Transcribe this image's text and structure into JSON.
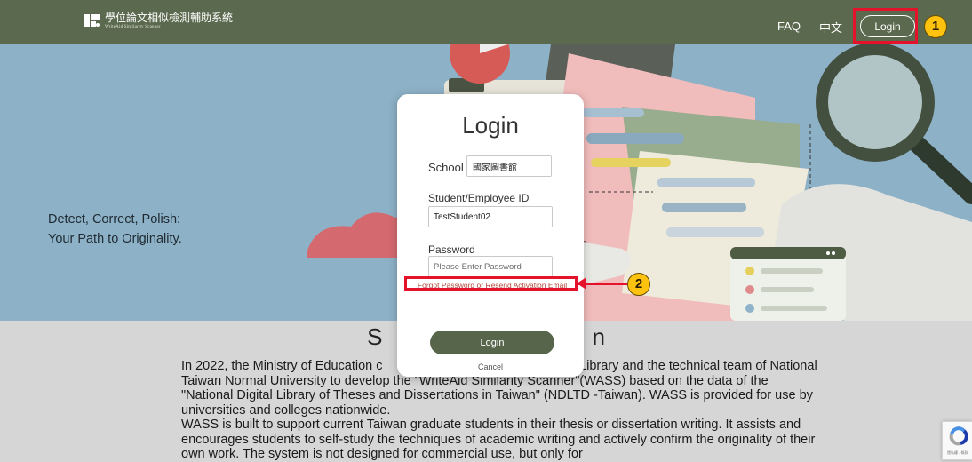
{
  "header": {
    "brand_title": "學位論文相似檢測輔助系統",
    "brand_subtitle": "WriteAid Similarity Scanner",
    "nav": {
      "faq": "FAQ",
      "language": "中文",
      "login": "Login"
    },
    "colors": {
      "bar": "#5b6a4e",
      "highlight": "#e4122b",
      "badge": "#ffc20e"
    }
  },
  "annotations": {
    "badge_1": "1",
    "badge_2": "2"
  },
  "hero": {
    "tagline_line1": "Detect, Correct, Polish:",
    "tagline_line2": "Your Path to Originality.",
    "background": "#8db1c6"
  },
  "about": {
    "title_left": "S",
    "title_right": "n",
    "paragraph_1": "In 2022, the Ministry of Education c                                               ntral Library and the technical team of National Taiwan Normal University to develop the \"WriteAid Similarity Scanner\"(WASS) based on the data of the \"National Digital Library of Theses and Dissertations in Taiwan\" (NDLTD -Taiwan). WASS is provided for use by universities and colleges nationwide.",
    "paragraph_2": "WASS is built to support current Taiwan graduate students in their thesis or dissertation writing. It assists and encourages students to self-study the techniques of academic writing and actively confirm the originality of their own work. The system is not designed for commercial use, but only for"
  },
  "modal": {
    "title": "Login",
    "school_label": "School",
    "school_value": "國家圖書館",
    "id_label": "Student/Employee ID",
    "id_value": "TestStudent02",
    "password_label": "Password",
    "password_placeholder": "Please Enter Password",
    "forgot_link": "Forgot Password or Resend Activation Email",
    "login_button": "Login",
    "cancel_link": "Cancel",
    "button_color": "#57654a"
  },
  "recaptcha": {
    "text": "隱私權 - 條款"
  }
}
